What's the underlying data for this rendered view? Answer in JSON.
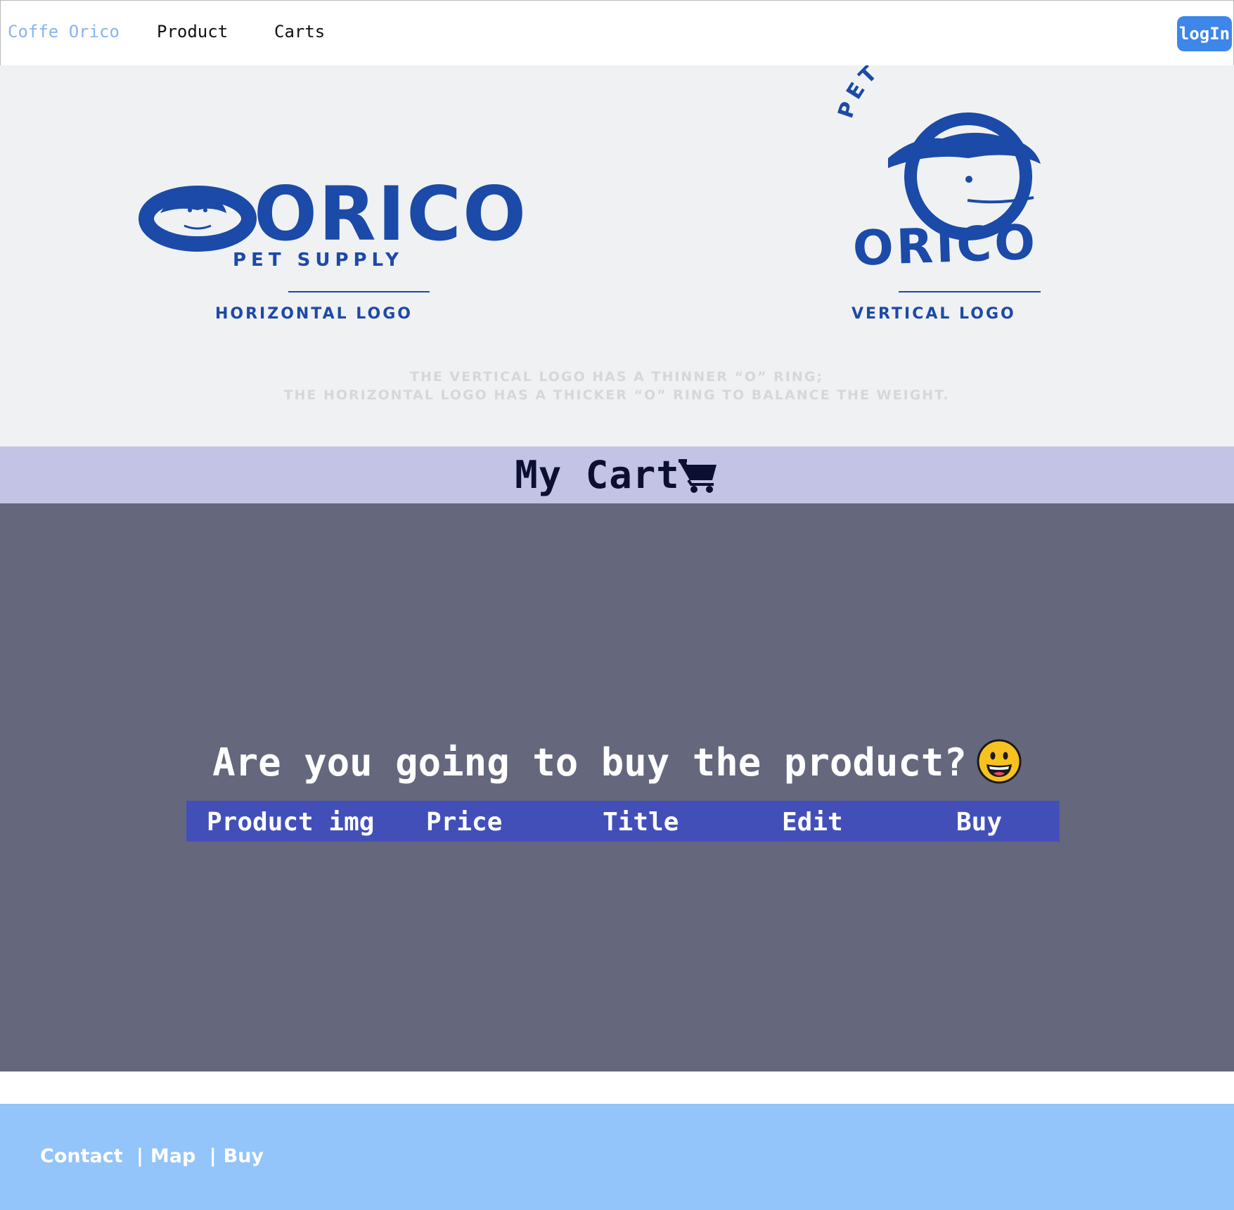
{
  "navbar": {
    "brand": "Coffe Orico",
    "links": [
      {
        "label": "Product"
      },
      {
        "label": "Carts"
      }
    ],
    "login_label": "logIn"
  },
  "banner": {
    "horizontal_logo": {
      "wordmark": "ORICO",
      "subtitle": "PET SUPPLY",
      "caption": "HORIZONTAL LOGO"
    },
    "vertical_logo": {
      "arc_text": "PET SUPPLY",
      "wordmark": "ORICO",
      "caption": "VERTICAL LOGO"
    },
    "note_line_1": "THE VERTICAL LOGO HAS A THINNER “O” RING;",
    "note_line_2": "THE HORIZONTAL LOGO HAS A THICKER “O” RING TO BALANCE THE WEIGHT.",
    "logo_color": "#1b4aa8"
  },
  "cart": {
    "title": "My Cart",
    "title_icon": "shopping-cart-icon",
    "question": "Are you going to buy the product?",
    "question_icon": "grinning-face-emoji",
    "columns": [
      "Product img",
      "Price",
      "Title",
      "Edit",
      "Buy"
    ]
  },
  "footer": {
    "links": [
      "Contact",
      "Map",
      "Buy"
    ],
    "separator": "|"
  },
  "colors": {
    "brand": "#89b4ef",
    "login_button": "#3d86ea",
    "cart_header_bg": "#c2c3e5",
    "cart_body_bg": "#65677d",
    "table_header_bg": "#434fb9",
    "footer_bg": "#93c4fa"
  }
}
